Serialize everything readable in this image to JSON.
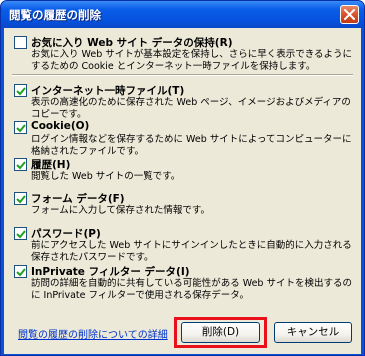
{
  "window": {
    "title": "閲覧の履歴の削除",
    "colors": {
      "titlebar": "#0653e0",
      "client": "#ece9d8",
      "highlight": "#e8101a",
      "link": "#0033cc"
    }
  },
  "items": [
    {
      "label": "お気に入り Web サイト データの保持(R)",
      "checked": false,
      "desc": "お気に入り Web サイトが基本設定を保持し、さらに早く表示できるようにするための Cookie とインターネット一時ファイルを保持します。"
    },
    {
      "label": "インターネット一時ファイル(T)",
      "checked": true,
      "desc": "表示の高速化のために保存された Web ページ、イメージおよびメディアのコピーです。"
    },
    {
      "label": "Cookie(O)",
      "checked": true,
      "desc": "ログイン情報などを保存するために Web サイトによってコンピューターに格納されたファイルです。"
    },
    {
      "label": "履歴(H)",
      "checked": true,
      "desc": "閲覧した Web サイトの一覧です。"
    },
    {
      "label": "フォーム データ(F)",
      "checked": true,
      "desc": "フォームに入力して保存された情報です。"
    },
    {
      "label": "パスワード(P)",
      "checked": true,
      "desc": "前にアクセスした Web サイトにサインインしたときに自動的に入力される保存されたパスワードです。"
    },
    {
      "label": "InPrivate フィルター データ(I)",
      "checked": true,
      "desc": "訪問の詳細を自動的に共有している可能性がある Web サイトを検出するのに InPrivate フィルターで使用される保存データ。"
    }
  ],
  "footer": {
    "link": "閲覧の履歴の削除についての詳細",
    "delete_label": "削除(D)",
    "cancel_label": "キャンセル"
  }
}
